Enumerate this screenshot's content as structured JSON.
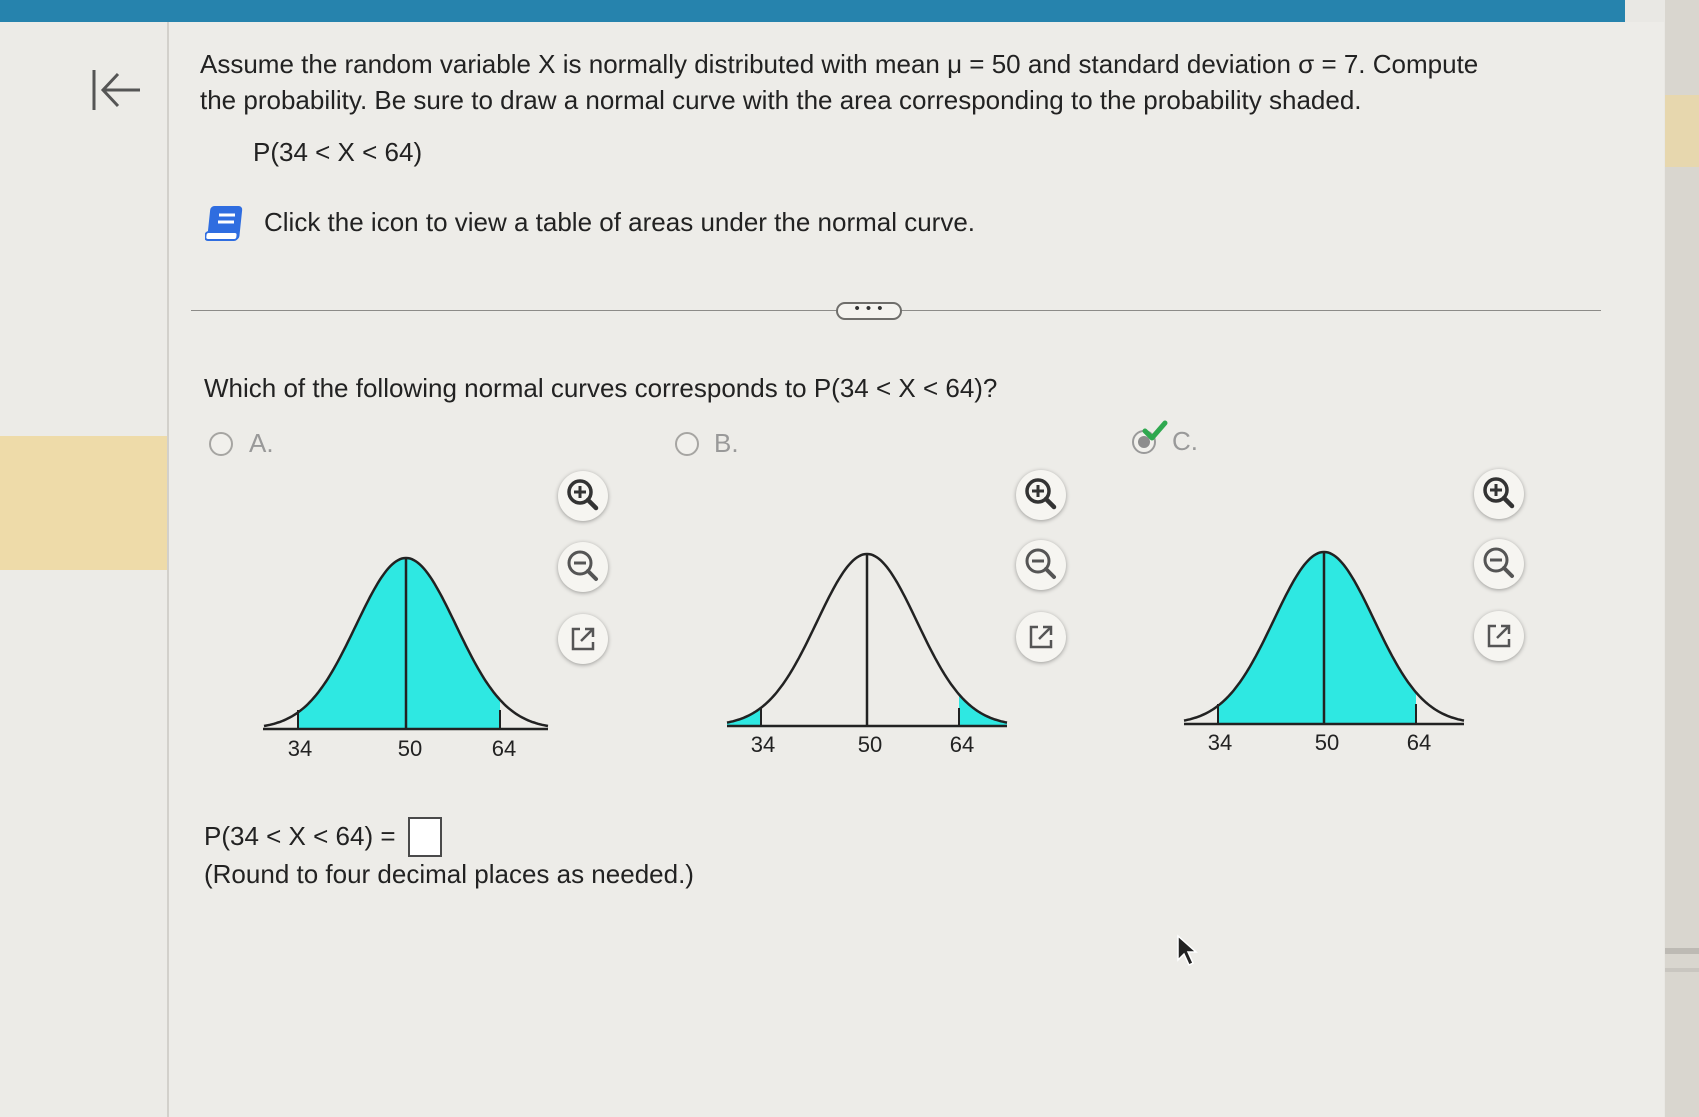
{
  "question": {
    "line1": "Assume the random variable X is normally distributed with mean μ = 50 and standard deviation σ = 7. Compute",
    "line2": "the probability. Be sure to draw a normal curve with the area corresponding to the probability shaded.",
    "expression": "P(34 < X < 64)",
    "table_link": "Click the icon to view a table of areas under the normal curve."
  },
  "part": {
    "prompt": "Which of the following normal curves corresponds to P(34 < X < 64)?",
    "options": [
      {
        "label": "A.",
        "shading": "34 to 64",
        "selected": false
      },
      {
        "label": "B.",
        "shading": "tails",
        "selected": false
      },
      {
        "label": "C.",
        "shading": "34 to 64",
        "selected": true
      }
    ],
    "ticks": [
      "34",
      "50",
      "64"
    ],
    "answer_prompt": "P(34 < X < 64) =",
    "answer_value": "",
    "round_note": "(Round to four decimal places as needed.)"
  },
  "dots_label": "• • •",
  "colors": {
    "shade": "#2ee8e2",
    "topbar": "#2683ad",
    "check": "#2fa84f"
  },
  "icons": [
    "back-arrow-icon",
    "book-icon",
    "zoom-in-icon",
    "zoom-out-icon",
    "external-link-icon",
    "check-icon",
    "mouse-cursor-icon"
  ]
}
